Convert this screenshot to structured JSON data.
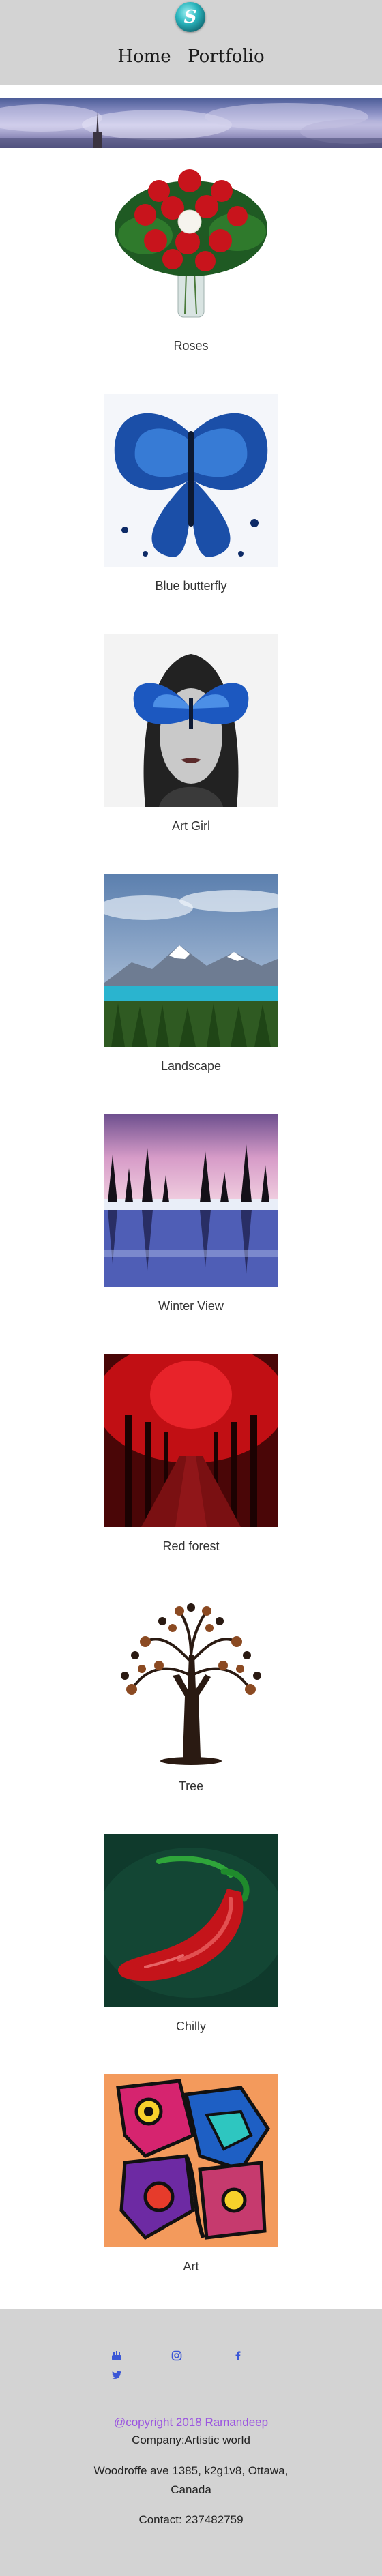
{
  "header": {
    "logo_letter": "S",
    "nav": [
      "Home",
      "Portfolio"
    ]
  },
  "gallery": [
    {
      "caption": "Roses"
    },
    {
      "caption": "Blue butterfly"
    },
    {
      "caption": "Art Girl"
    },
    {
      "caption": "Landscape"
    },
    {
      "caption": "Winter View"
    },
    {
      "caption": "Red forest"
    },
    {
      "caption": "Tree"
    },
    {
      "caption": "Chilly"
    },
    {
      "caption": "Art"
    }
  ],
  "footer": {
    "social": [
      "youtube-icon",
      "instagram-icon",
      "facebook-icon",
      "twitter-icon"
    ],
    "copyright": "@copyright 2018 Ramandeep",
    "company": "Company:Artistic world",
    "address_line1": "Woodroffe ave 1385, k2g1v8, Ottawa,",
    "address_line2": "Canada",
    "contact": "Contact: 237482759"
  },
  "colors": {
    "header_bg": "#d3d3d3",
    "link": "#3b57d6",
    "copyright": "#9b55e0"
  }
}
